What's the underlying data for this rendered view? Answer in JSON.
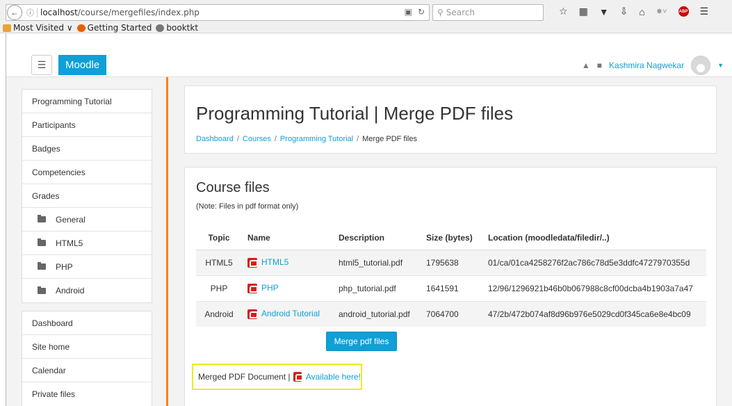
{
  "browser": {
    "url_host": "localhost",
    "url_path": "/course/mergefiles/index.php",
    "search_placeholder": "Search",
    "bookmarks": [
      {
        "label": "Most Visited ∨"
      },
      {
        "label": "Getting Started"
      },
      {
        "label": "booktkt"
      }
    ]
  },
  "navbar": {
    "brand": "Moodle",
    "user_name": "Kashmira Nagwekar"
  },
  "sidebar": {
    "course_block": [
      {
        "label": "Programming Tutorial"
      },
      {
        "label": "Participants"
      },
      {
        "label": "Badges"
      },
      {
        "label": "Competencies"
      },
      {
        "label": "Grades"
      },
      {
        "label": "General",
        "folder": true
      },
      {
        "label": "HTML5",
        "folder": true
      },
      {
        "label": "PHP",
        "folder": true
      },
      {
        "label": "Android",
        "folder": true
      }
    ],
    "site_block": [
      {
        "label": "Dashboard"
      },
      {
        "label": "Site home"
      },
      {
        "label": "Calendar"
      },
      {
        "label": "Private files"
      }
    ]
  },
  "header": {
    "title": "Programming Tutorial | Merge PDF files",
    "breadcrumb": [
      {
        "label": "Dashboard",
        "link": true
      },
      {
        "label": "Courses",
        "link": true
      },
      {
        "label": "Programming Tutorial",
        "link": true
      },
      {
        "label": "Merge PDF files",
        "link": false
      }
    ]
  },
  "files": {
    "title": "Course files",
    "note": "(Note: Files in pdf format only)",
    "columns": [
      "Topic",
      "Name",
      "Description",
      "Size (bytes)",
      "Location (moodledata/filedir/..)"
    ],
    "rows": [
      {
        "topic": "HTML5",
        "name": "HTML5",
        "description": "html5_tutorial.pdf",
        "size": "1795638",
        "location": "01/ca/01ca4258276f2ac786c78d5e3ddfc4727970355d"
      },
      {
        "topic": "PHP",
        "name": "PHP",
        "description": "php_tutorial.pdf",
        "size": "1641591",
        "location": "12/96/1296921b46b0b067988c8cf00dcba4b1903a7a47"
      },
      {
        "topic": "Android",
        "name": "Android Tutorial",
        "description": "android_tutorial.pdf",
        "size": "7064700",
        "location": "47/2b/472b074af8d96b976e5029cd0f345ca6e8e4bc09"
      }
    ],
    "merge_button": "Merge pdf files",
    "merged_label": "Merged PDF Document |",
    "merged_link": "Available here!"
  }
}
